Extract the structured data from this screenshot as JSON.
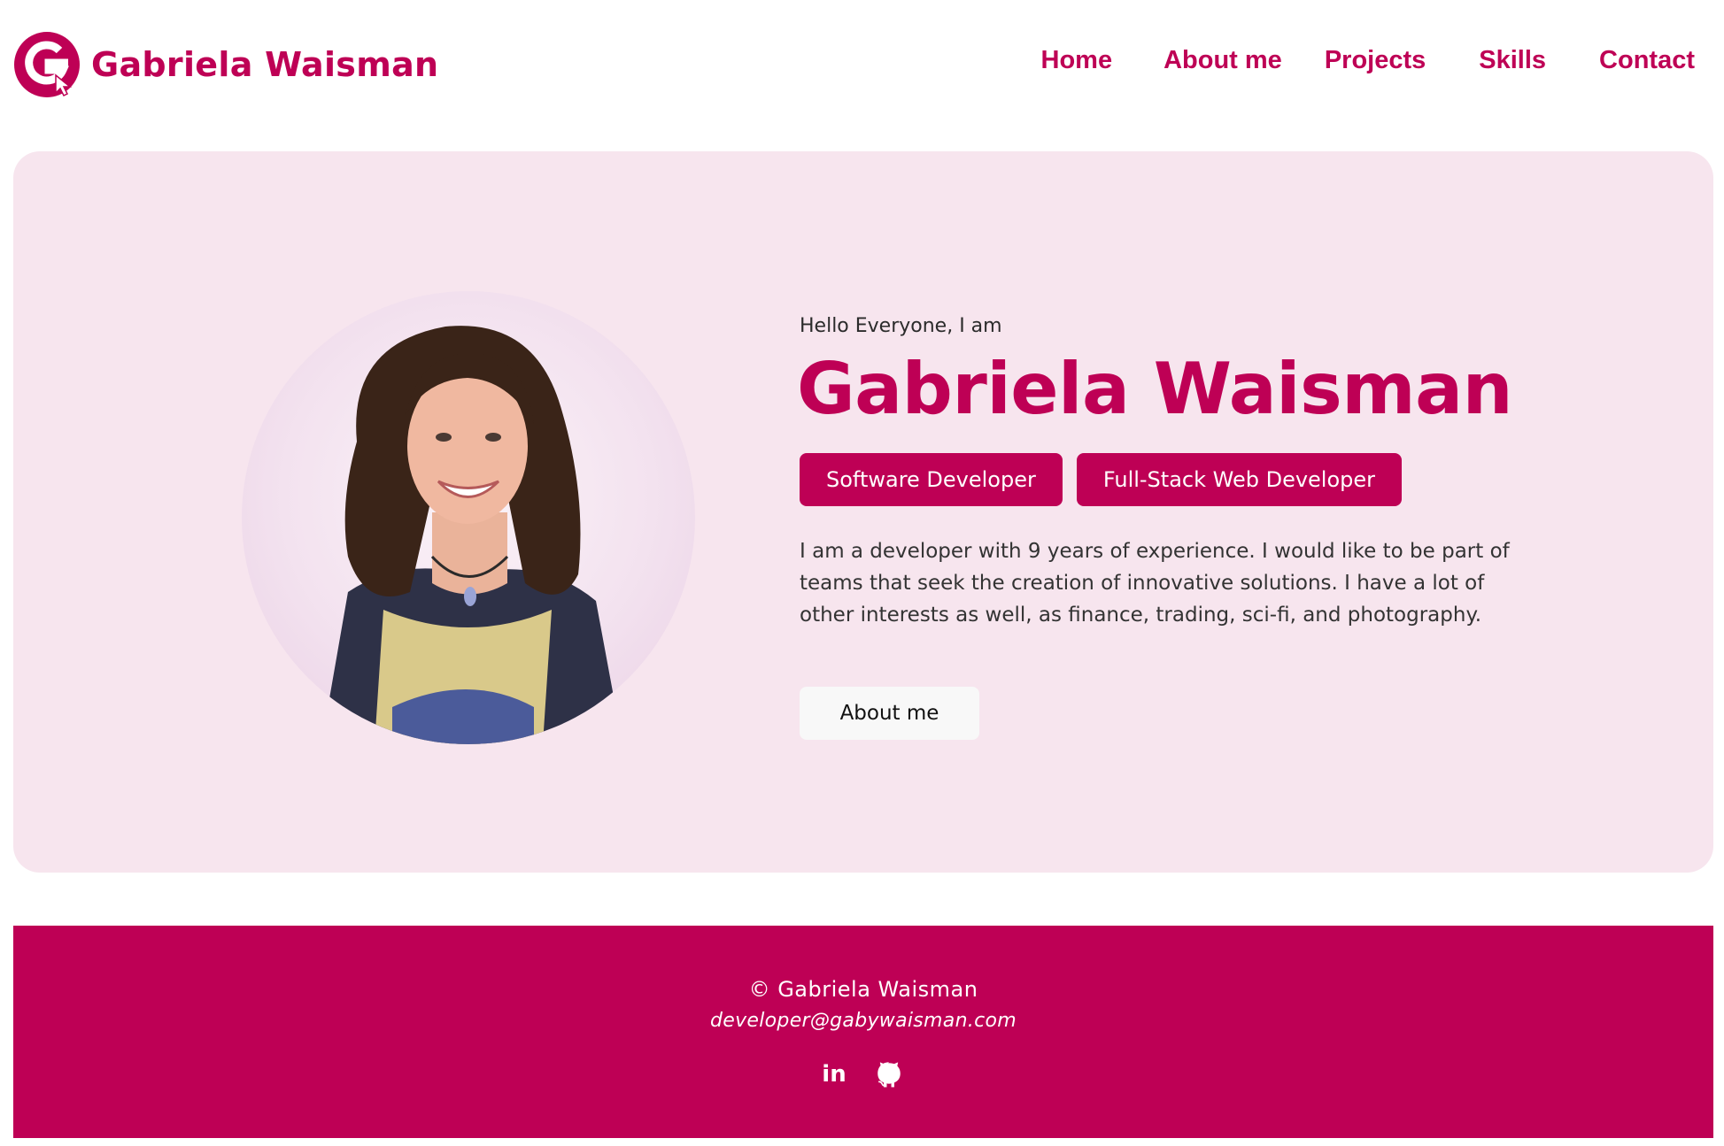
{
  "header": {
    "brand_name": "Gabriela Waisman",
    "logo_icon": "g-cursor-logo-icon",
    "nav": [
      "Home",
      "About me",
      "Projects",
      "Skills",
      "Contact"
    ]
  },
  "hero": {
    "intro": "Hello Everyone, I am",
    "name": "Gabriela Waisman",
    "roles": [
      "Software Developer",
      "Full-Stack Web Developer"
    ],
    "bio": "I am a developer with 9 years of experience. I would like to be part of teams that seek the creation of innovative solutions. I have a lot of other interests as well, as finance, trading, sci-fi, and photography.",
    "cta_label": "About me"
  },
  "footer": {
    "copyright": "© Gabriela Waisman",
    "email": "developer@gabywaisman.com",
    "social_icons": [
      "linkedin-icon",
      "github-icon"
    ],
    "linkedin_glyph": "in"
  },
  "colors": {
    "accent": "#be0055",
    "hero_bg": "#f7e5ee",
    "button_light": "#f8f8f8",
    "text_dark": "#333333"
  }
}
